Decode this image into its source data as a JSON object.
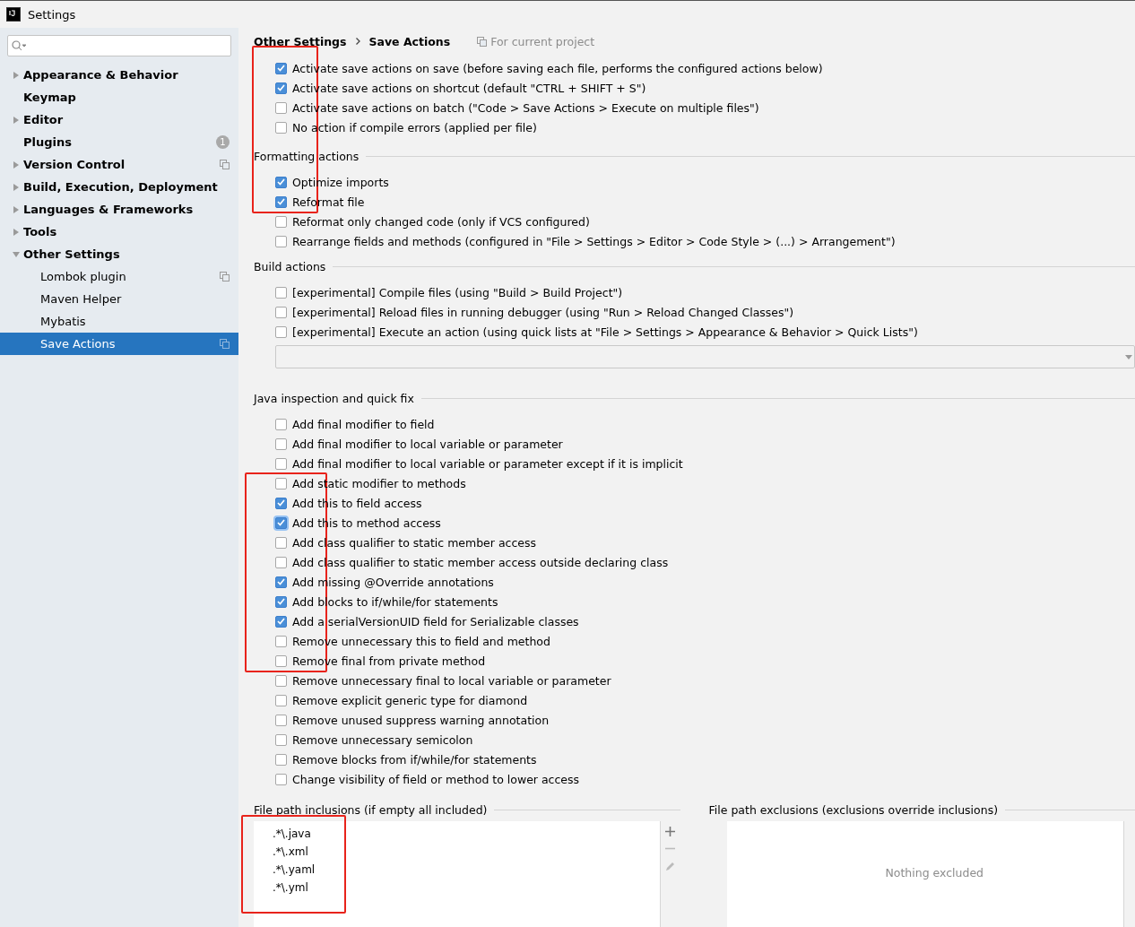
{
  "window": {
    "title": "Settings"
  },
  "sidebar": {
    "items": [
      {
        "label": "Appearance & Behavior",
        "expandable": true,
        "expanded": false,
        "selected": false
      },
      {
        "label": "Keymap",
        "expandable": false,
        "selected": false
      },
      {
        "label": "Editor",
        "expandable": true,
        "expanded": false,
        "selected": false
      },
      {
        "label": "Plugins",
        "expandable": false,
        "selected": false,
        "badge": "1"
      },
      {
        "label": "Version Control",
        "expandable": true,
        "expanded": false,
        "selected": false,
        "project_level": true
      },
      {
        "label": "Build, Execution, Deployment",
        "expandable": true,
        "expanded": false,
        "selected": false
      },
      {
        "label": "Languages & Frameworks",
        "expandable": true,
        "expanded": false,
        "selected": false
      },
      {
        "label": "Tools",
        "expandable": true,
        "expanded": false,
        "selected": false
      },
      {
        "label": "Other Settings",
        "expandable": true,
        "expanded": true,
        "selected": false,
        "children": [
          {
            "label": "Lombok plugin",
            "selected": false,
            "project_level": true
          },
          {
            "label": "Maven Helper",
            "selected": false
          },
          {
            "label": "Mybatis",
            "selected": false
          },
          {
            "label": "Save Actions",
            "selected": true,
            "project_level": true
          }
        ]
      }
    ]
  },
  "breadcrumb": [
    "Other Settings",
    "Save Actions"
  ],
  "scope": "For current project",
  "sections": [
    {
      "options": [
        {
          "label": "Activate save actions on save (before saving each file, performs the configured actions below)",
          "checked": true
        },
        {
          "label": "Activate save actions on shortcut (default \"CTRL + SHIFT + S\")",
          "checked": true
        },
        {
          "label": "Activate save actions on batch (\"Code > Save Actions > Execute on multiple files\")",
          "checked": false
        },
        {
          "label": "No action if compile errors (applied per file)",
          "checked": false
        }
      ]
    },
    {
      "title": "Formatting actions",
      "options": [
        {
          "label": "Optimize imports",
          "checked": true
        },
        {
          "label": "Reformat file",
          "checked": true
        },
        {
          "label": "Reformat only changed code (only if VCS configured)",
          "checked": false
        },
        {
          "label": "Rearrange fields and methods (configured in \"File > Settings > Editor > Code Style > (...) > Arrangement\")",
          "checked": false
        }
      ]
    },
    {
      "title": "Build actions",
      "has_dropdown": true,
      "options": [
        {
          "label": "[experimental] Compile files (using \"Build > Build Project\")",
          "checked": false
        },
        {
          "label": "[experimental] Reload files in running debugger (using \"Run > Reload Changed Classes\")",
          "checked": false
        },
        {
          "label": "[experimental] Execute an action (using quick lists at \"File > Settings > Appearance & Behavior > Quick Lists\")",
          "checked": false
        }
      ]
    },
    {
      "title": "Java inspection and quick fix",
      "options": [
        {
          "label": "Add final modifier to field",
          "checked": false
        },
        {
          "label": "Add final modifier to local variable or parameter",
          "checked": false
        },
        {
          "label": "Add final modifier to local variable or parameter except if it is implicit",
          "checked": false
        },
        {
          "label": "Add static modifier to methods",
          "checked": false
        },
        {
          "label": "Add this to field access",
          "checked": true
        },
        {
          "label": "Add this to method access",
          "checked": true,
          "focused": true
        },
        {
          "label": "Add class qualifier to static member access",
          "checked": false
        },
        {
          "label": "Add class qualifier to static member access outside declaring class",
          "checked": false
        },
        {
          "label": "Add missing @Override annotations",
          "checked": true
        },
        {
          "label": "Add blocks to if/while/for statements",
          "checked": true
        },
        {
          "label": "Add a serialVersionUID field for Serializable classes",
          "checked": true
        },
        {
          "label": "Remove unnecessary this to field and method",
          "checked": false
        },
        {
          "label": "Remove final from private method",
          "checked": false
        },
        {
          "label": "Remove unnecessary final to local variable or parameter",
          "checked": false
        },
        {
          "label": "Remove explicit generic type for diamond",
          "checked": false
        },
        {
          "label": "Remove unused suppress warning annotation",
          "checked": false
        },
        {
          "label": "Remove unnecessary semicolon",
          "checked": false
        },
        {
          "label": "Remove blocks from if/while/for statements",
          "checked": false
        },
        {
          "label": "Change visibility of field or method to lower access",
          "checked": false
        }
      ]
    }
  ],
  "inclusions": {
    "title": "File path inclusions (if empty all included)",
    "items": [
      ".*\\.java",
      ".*\\.xml",
      ".*\\.yaml",
      ".*\\.yml"
    ]
  },
  "exclusions": {
    "title": "File path exclusions (exclusions override inclusions)",
    "empty_text": "Nothing excluded"
  }
}
